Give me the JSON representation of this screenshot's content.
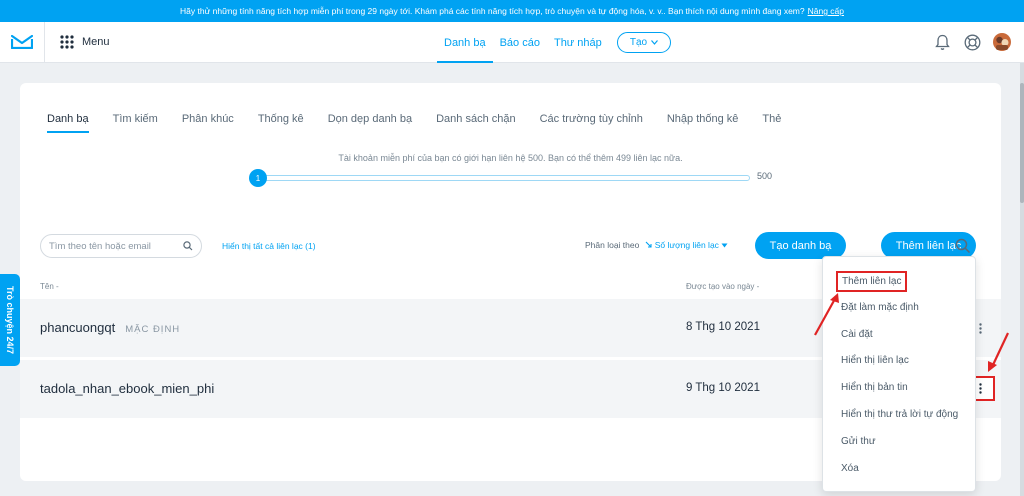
{
  "promo_bar": {
    "text": "Hãy thử những tính năng tích hợp miễn phí trong 29 ngày tới. Khám phá các tính năng tích hợp, trò chuyện và tự động hóa, v. v.. Bạn thích nội dung mình đang xem?",
    "link": "Nâng cấp"
  },
  "topnav": {
    "menu_label": "Menu",
    "links": [
      "Danh bạ",
      "Báo cáo",
      "Thư nháp"
    ],
    "create_label": "Tạo"
  },
  "subtabs": [
    "Danh bạ",
    "Tìm kiếm",
    "Phân khúc",
    "Thống kê",
    "Dọn dẹp danh bạ",
    "Danh sách chặn",
    "Các trường tùy chỉnh",
    "Nhập thống kê",
    "Thẻ"
  ],
  "limit": {
    "text": "Tài khoản miễn phí của bạn có giới hạn liên hệ 500. Bạn có thể thêm 499 liên lạc nữa.",
    "current": "1",
    "max": "500"
  },
  "toolbar": {
    "search_placeholder": "Tìm theo tên hoặc email",
    "show_all": "Hiển thị tất cả liên lạc (1)",
    "sort_label": "Phân loại theo",
    "sort_value": "Số lượng liên lạc",
    "create_list": "Tạo danh bạ",
    "add_contact": "Thêm liên lạc"
  },
  "columns": {
    "name": "Tên",
    "created": "Được tạo vào ngày"
  },
  "lists": [
    {
      "name": "phancuongqt",
      "badge": "MẶC ĐỊNH",
      "date": "8 Thg 10 2021"
    },
    {
      "name": "tadola_nhan_ebook_mien_phi",
      "badge": "",
      "date": "9 Thg 10 2021"
    }
  ],
  "chat_tab": "Trò chuyện 24/7",
  "dropdown": [
    "Thêm liên lạc",
    "Đặt làm mặc định",
    "Cài đặt",
    "Hiển thị liên lạc",
    "Hiển thị bản tin",
    "Hiển thị thư trả lời tự động",
    "Gửi thư",
    "Xóa"
  ],
  "colors": {
    "accent": "#00a2f2",
    "annotation": "#e02424"
  }
}
